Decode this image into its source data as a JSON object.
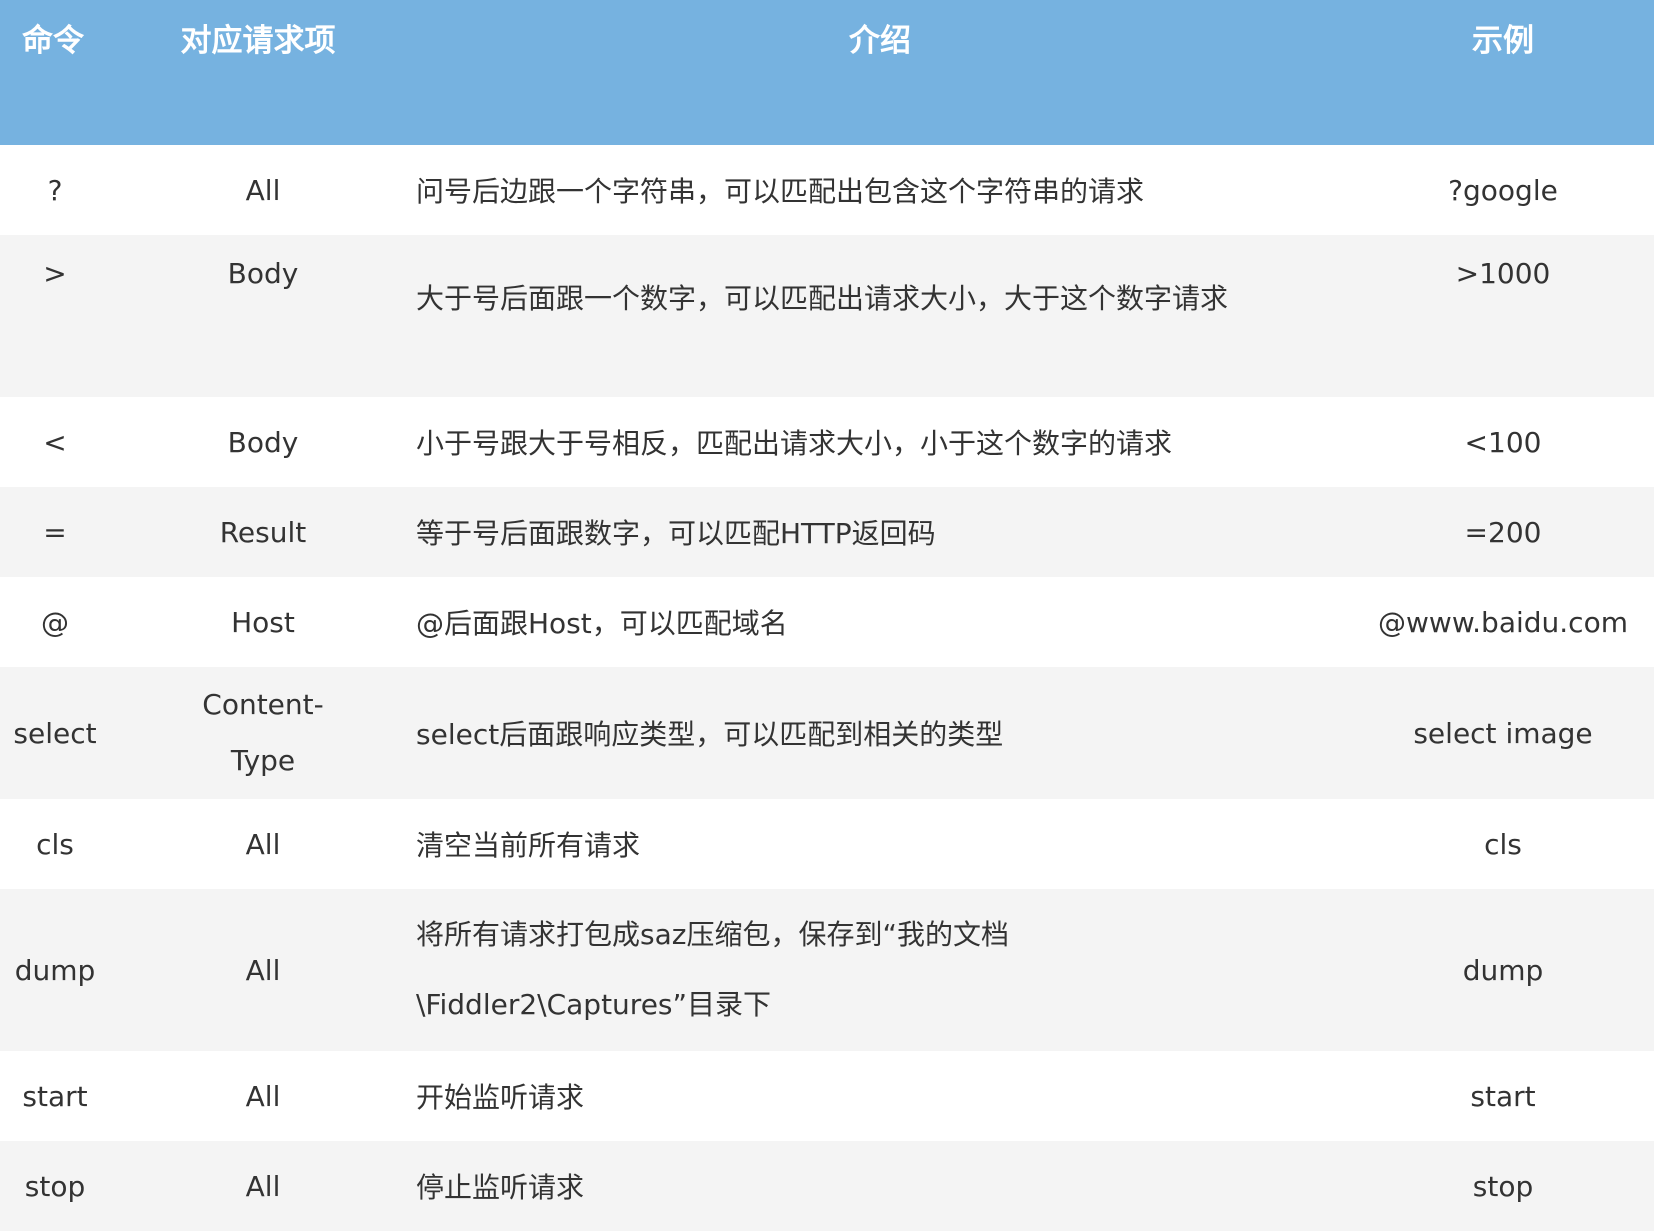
{
  "table": {
    "headers": {
      "command": "命令",
      "request_item": "对应请求项",
      "intro": "介绍",
      "example": "示例"
    },
    "rows": [
      {
        "command": "?",
        "request_item": "All",
        "intro": "问号后边跟一个字符串，可以匹配出包含这个字符串的请求",
        "example": "?google"
      },
      {
        "command": ">",
        "request_item": "Body",
        "intro": "大于号后面跟一个数字，可以匹配出请求大小，大于这个数字请求",
        "example": ">1000"
      },
      {
        "command": "<",
        "request_item": "Body",
        "intro": "小于号跟大于号相反，匹配出请求大小，小于这个数字的请求",
        "example": "<100"
      },
      {
        "command": "=",
        "request_item": "Result",
        "intro": "等于号后面跟数字，可以匹配HTTP返回码",
        "example": "=200"
      },
      {
        "command": "@",
        "request_item": "Host",
        "intro": "@后面跟Host，可以匹配域名",
        "example": "@www.baidu.com"
      },
      {
        "command": "select",
        "request_item": "Content-Type",
        "intro": "select后面跟响应类型，可以匹配到相关的类型",
        "example": "select image"
      },
      {
        "command": "cls",
        "request_item": "All",
        "intro": "清空当前所有请求",
        "example": "cls"
      },
      {
        "command": "dump",
        "request_item": "All",
        "intro": "将所有请求打包成saz压缩包，保存到“我的文档\\Fiddler2\\Captures”目录下",
        "example": "dump"
      },
      {
        "command": "start",
        "request_item": "All",
        "intro": "开始监听请求",
        "example": "start"
      },
      {
        "command": "stop",
        "request_item": "All",
        "intro": "停止监听请求",
        "example": "stop"
      }
    ]
  },
  "colors": {
    "header_bg": "#76b2e0",
    "header_text": "#ffffff",
    "row_alt_bg": "#f4f4f4",
    "text": "#333333"
  }
}
